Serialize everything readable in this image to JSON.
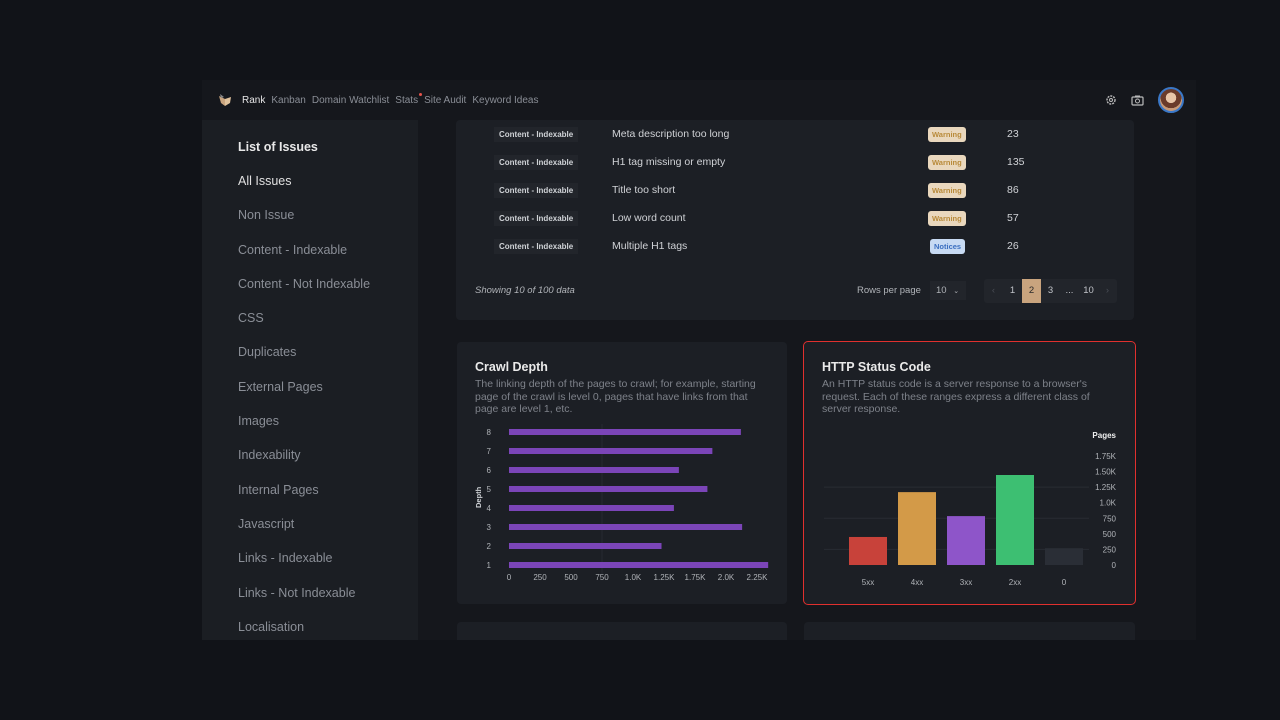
{
  "nav": {
    "items": [
      {
        "label": "Rank",
        "active": true
      },
      {
        "label": "Kanban"
      },
      {
        "label": "Domain Watchlist"
      },
      {
        "label": "Stats",
        "notification_dot": true
      },
      {
        "label": "Site Audit"
      },
      {
        "label": "Keyword Ideas"
      }
    ],
    "icons": [
      "settings-gear-icon",
      "camera-icon",
      "user-avatar"
    ]
  },
  "sidebar": {
    "title": "List of Issues",
    "items": [
      "All Issues",
      "Non Issue",
      "Content - Indexable",
      "Content - Not Indexable",
      "CSS",
      "Duplicates",
      "External Pages",
      "Images",
      "Indexability",
      "Internal Pages",
      "Javascript",
      "Links - Indexable",
      "Links - Not Indexable",
      "Localisation"
    ],
    "selected": "All Issues"
  },
  "table": {
    "rows": [
      {
        "category": "Content - Indexable",
        "issue": "Meta description too long",
        "type": "Warning",
        "count": "23"
      },
      {
        "category": "Content - Indexable",
        "issue": "H1 tag missing or empty",
        "type": "Warning",
        "count": "135"
      },
      {
        "category": "Content - Indexable",
        "issue": "Title too short",
        "type": "Warning",
        "count": "86"
      },
      {
        "category": "Content - Indexable",
        "issue": "Low word count",
        "type": "Warning",
        "count": "57"
      },
      {
        "category": "Content - Indexable",
        "issue": "Multiple H1 tags",
        "type": "Notices",
        "count": "26"
      }
    ],
    "showing": "Showing 10 of 100 data",
    "rows_per_page_label": "Rows per page",
    "rows_per_page": "10",
    "pages": [
      "1",
      "2",
      "3",
      "...",
      "10"
    ],
    "current_page": "2"
  },
  "chart_data": [
    {
      "type": "bar",
      "orientation": "horizontal",
      "title": "Crawl Depth",
      "subtitle": "The linking depth of the pages to crawl; for example, starting page of the crawl is level 0, pages that have links from that page are level 1, etc.",
      "ylabel": "Depth",
      "xlabel": "",
      "categories": [
        "8",
        "7",
        "6",
        "5",
        "4",
        "3",
        "2",
        "1"
      ],
      "values": [
        1870,
        1640,
        1370,
        1600,
        1330,
        1880,
        1230,
        2090
      ],
      "x_tick_labels": [
        "0",
        "250",
        "500",
        "750",
        "1.0K",
        "1.25K",
        "1.75K",
        "2.0K",
        "2.25K"
      ],
      "xlim": [
        0,
        2250
      ],
      "color": "#7b45b8"
    },
    {
      "type": "bar",
      "title": "HTTP Status Code",
      "subtitle": "An HTTP status code is a server response to a browser's request. Each of these ranges express a different class of server response.",
      "ylabel": "Pages",
      "xlabel": "",
      "categories": [
        "5xx",
        "4xx",
        "3xx",
        "2xx",
        "0"
      ],
      "values": [
        450,
        1170,
        785,
        1445,
        270
      ],
      "colors": [
        "#c8423a",
        "#d39a48",
        "#8e55c9",
        "#3dbf72",
        "#2a2e36"
      ],
      "y_tick_labels": [
        "0",
        "250",
        "500",
        "750",
        "1.0K",
        "1.25K",
        "1.50K",
        "1.75K"
      ],
      "ylim": [
        0,
        1750
      ],
      "grid": true
    }
  ]
}
